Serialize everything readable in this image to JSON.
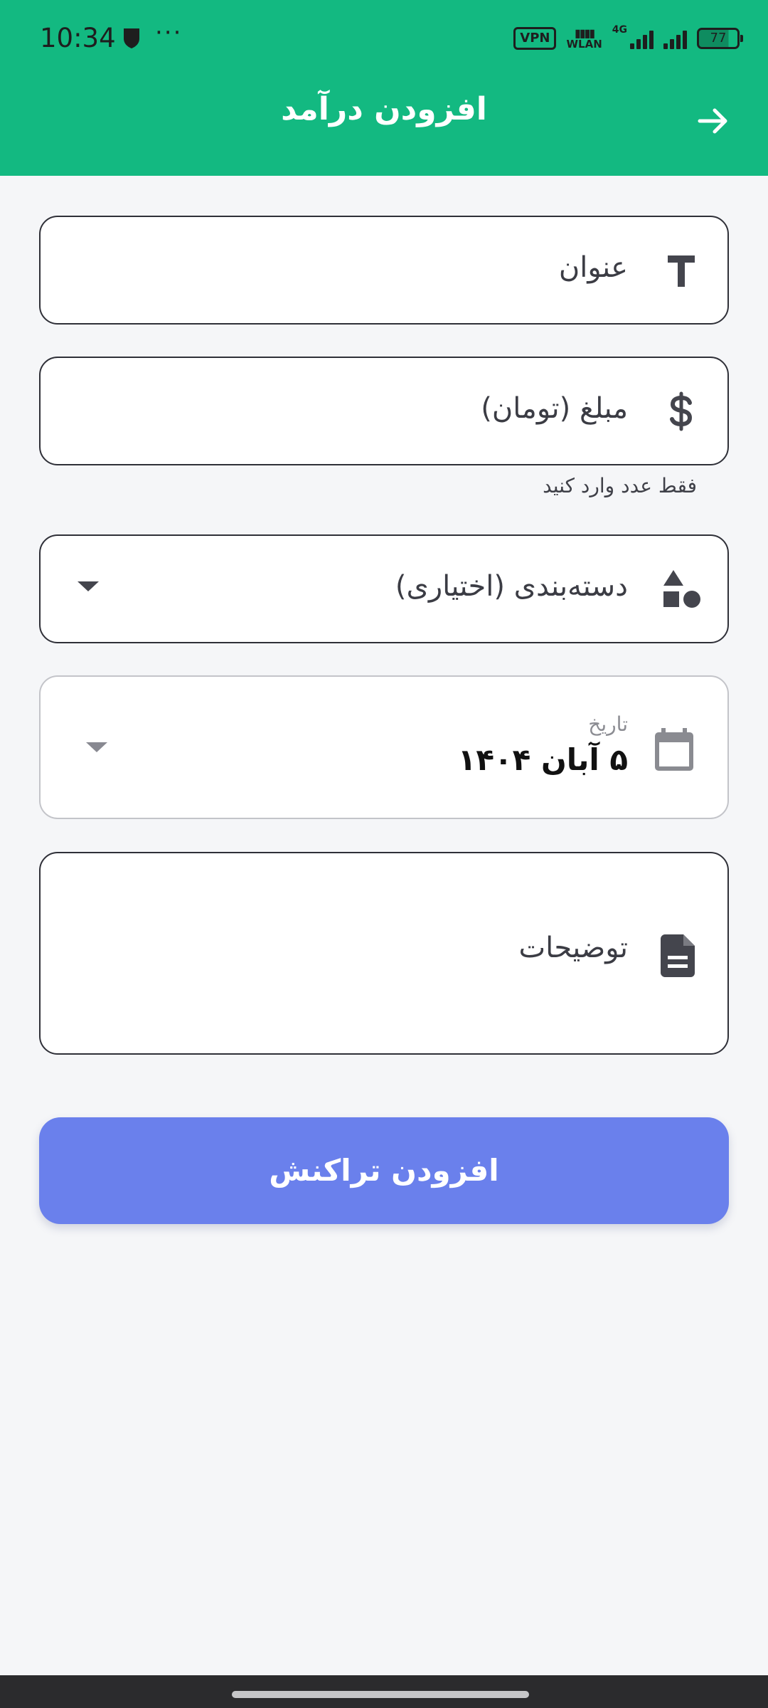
{
  "status_bar": {
    "time": "10:34",
    "more": "···",
    "vpn": "VPN",
    "wlan_label": "WLAN",
    "network": "4G",
    "battery": "77"
  },
  "app_bar": {
    "title": "افزودن درآمد"
  },
  "form": {
    "title_field": {
      "label": "عنوان"
    },
    "amount_field": {
      "label": "مبلغ (تومان)",
      "helper": "فقط عدد وارد کنید"
    },
    "category_field": {
      "label": "دسته‌بندی (اختیاری)"
    },
    "date_field": {
      "caption": "تاریخ",
      "value": "۵ آبان ۱۴۰۴"
    },
    "notes_field": {
      "label": "توضیحات"
    },
    "submit_label": "افزودن تراکنش"
  },
  "colors": {
    "app_bar": "#13b981",
    "button": "#6a80ec",
    "background": "#f5f6f8"
  },
  "icons": {
    "title": "text-icon",
    "amount": "dollar-icon",
    "category": "shapes-icon",
    "date": "calendar-icon",
    "notes": "document-icon",
    "back": "arrow-right-icon"
  }
}
